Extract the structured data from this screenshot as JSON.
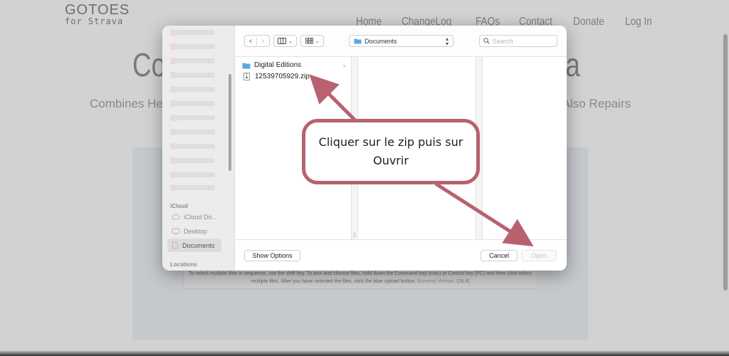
{
  "site": {
    "logo_main": "GOTOES",
    "logo_sub": "for Strava",
    "nav": [
      "Home",
      "ChangeLog",
      "FAQs",
      "Contact",
      "Donate",
      "Log In"
    ],
    "hero_title_left": "Cor",
    "hero_title_right": "va",
    "hero_sub_left": "Combines He",
    "hero_sub_right": "Also Repairs",
    "upload_help_line1": "To select multiple files in sequence, use the shift key. To pick and choose files, hold down the Command key (mac) or Control key (PC) and then click-select",
    "upload_help_line2": "multiple files. After you have selected the files, click the blue upload button.",
    "running_version_label": "Running Version:",
    "running_version": "(26.8)"
  },
  "dialog": {
    "sidebar": {
      "icloud_header": "iCloud",
      "items": [
        {
          "label": "iCloud Dri...",
          "icon": "cloud-icon",
          "selected": false
        },
        {
          "label": "Desktop",
          "icon": "desktop-icon",
          "selected": false
        },
        {
          "label": "Documents",
          "icon": "document-icon",
          "selected": true
        }
      ],
      "locations_header": "Locations"
    },
    "toolbar": {
      "location": "Documents",
      "search_placeholder": "Search"
    },
    "files": [
      {
        "name": "Digital Editions",
        "type": "folder"
      },
      {
        "name": "12539705929.zip",
        "type": "zip"
      }
    ],
    "footer": {
      "show_options": "Show Options",
      "cancel": "Cancel",
      "open": "Open"
    }
  },
  "annotation": {
    "text": "Cliquer sur le zip puis sur Ouvrir",
    "color": "#b8626f"
  },
  "colors": {
    "folder": "#5aa9e6",
    "accent": "#b8626f"
  }
}
